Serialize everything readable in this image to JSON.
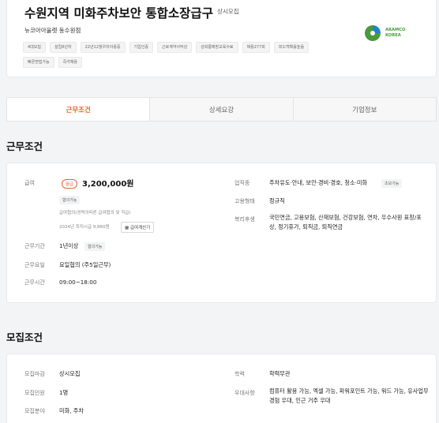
{
  "header": {
    "title": "수원지역 미화주차보안 통합소장급구",
    "badge": "상시모집",
    "company": "뉴코아아울렛 동수원점",
    "tags": [
      "4대보험",
      "설립8년차",
      "22년12월우미이용증",
      "기업인증",
      "근로계약서작성",
      "성희롱예방교육수료",
      "채용277회",
      "피드백확률높음",
      "빠른면접가능",
      "즉각채용"
    ],
    "logo": {
      "line1": "ARAMCO",
      "line2": "KOREA"
    }
  },
  "tabs": [
    "근무조건",
    "상세요강",
    "기업정보"
  ],
  "work": {
    "section_title": "근무조건",
    "pay_label": "급여",
    "pay_type": "월급",
    "pay_amount": "3,200,000원",
    "pay_negotiable": "협의가능",
    "pay_note": "급여협의(경력의따른 급여협의 및 직급)",
    "min_wage": "2024년 최저시급 9,860원",
    "calc_button": "급여계산기",
    "period_label": "근무기간",
    "period_value": "1년이상",
    "period_chip": "협의가능",
    "days_label": "근무요일",
    "days_value": "요일협의 (주5일근무)",
    "hours_label": "근무시간",
    "hours_value": "09:00~18:00",
    "job_label": "업직종",
    "job_value": "주차유도·안내, 보안·경비·경호, 청소·미화",
    "job_chip": "초보가능",
    "employ_label": "고용형태",
    "employ_value": "정규직",
    "benefits_label": "복리후생",
    "benefits_value": "국민연금, 고용보험, 산재보험, 건강보험, 연차, 우수사원 표창/포상, 정기휴가, 퇴직금, 퇴직연금"
  },
  "recruit": {
    "section_title": "모집조건",
    "deadline_label": "모집마감",
    "deadline_value": "상시모집",
    "headcount_label": "모집인원",
    "headcount_value": "1명",
    "field_label": "모집분야",
    "field_value": "미화, 주차",
    "edu_label": "학력",
    "edu_value": "학력무관",
    "pref_label": "우대사항",
    "pref_value": "컴퓨터 활용 가능, 엑셀 가능, 파워포인트 가능, 워드 가능, 유사업무 경험 우대, 인근 거주 우대"
  },
  "colors": {
    "accent": "#e8632c",
    "logo_green": "#4a9a3c"
  }
}
